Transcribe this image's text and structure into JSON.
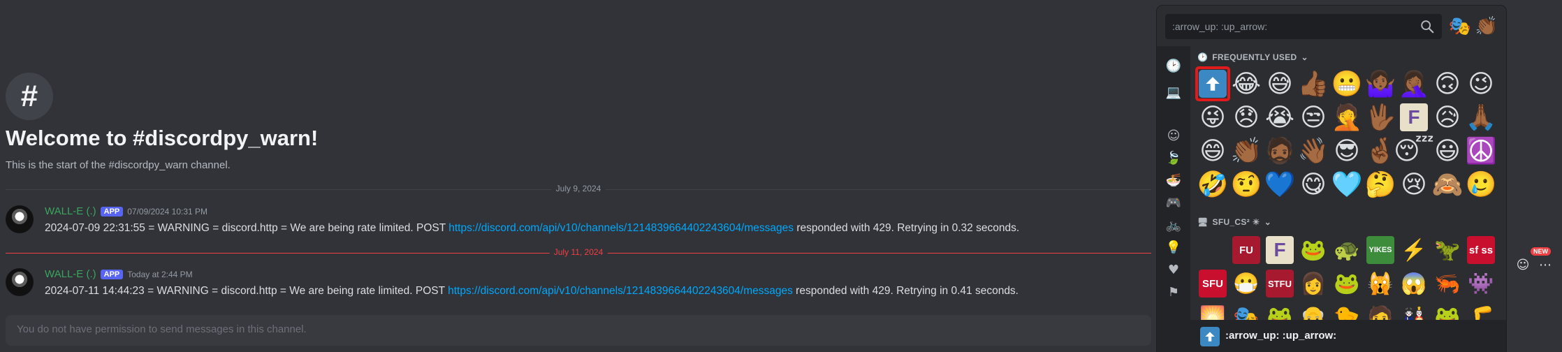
{
  "channel": {
    "hash": "#",
    "welcome_title": "Welcome to #discordpy_warn!",
    "welcome_subtitle": "This is the start of the #discordpy_warn channel."
  },
  "dividers": [
    "July 9, 2024",
    "July 11, 2024"
  ],
  "messages": [
    {
      "username": "WALL-E (.)",
      "badge": "APP",
      "timestamp": "07/09/2024 10:31 PM",
      "text_before": "2024-07-09 22:31:55 = WARNING = discord.http = We are being rate limited. POST ",
      "link": "https://discord.com/api/v10/channels/1214839664402243604/messages",
      "text_after": " responded with 429. Retrying in 0.32 seconds."
    },
    {
      "username": "WALL-E (.)",
      "badge": "APP",
      "timestamp": "Today at 2:44 PM",
      "text_before": "2024-07-11 14:44:23 = WARNING = discord.http = We are being rate limited. POST ",
      "link": "https://discord.com/api/v10/channels/1214839664402243604/messages",
      "text_after": " responded with 429. Retrying in 0.41 seconds."
    }
  ],
  "composer": {
    "placeholder": "You do not have permission to send messages in this channel."
  },
  "side": {
    "new_badge": "NEW"
  },
  "picker": {
    "search_value": ":arrow_up: :up_arrow:",
    "section_frequent": "FREQUENTLY USED",
    "section_server": "SFU_CS² ☀",
    "frequent_emojis": [
      "⬆",
      "😂",
      "😅",
      "👍🏾",
      "😬",
      "🤷🏾‍♀️",
      "🤦🏾‍♀️",
      "🙃",
      "😉",
      "😜",
      "😞",
      "😭",
      "😒",
      "🤦",
      "🖖🏾",
      "F",
      "😥",
      "🙏🏾",
      "😄",
      "👏🏾",
      "🧔🏾",
      "👋🏾",
      "😎",
      "🤞🏾",
      "😴",
      "😃",
      "☮️",
      "🤣",
      "🤨",
      "💙",
      "😋",
      "🩵",
      "🤔",
      "😢",
      "🙈",
      "🥲"
    ],
    "server_stickers": [
      {
        "label": "",
        "color": "#2b2d31"
      },
      {
        "label": "FU",
        "color": "#a6192e"
      },
      {
        "label": "F",
        "color": "#e8e0c8"
      },
      {
        "label": "🐸",
        "color": "#2b2d31"
      },
      {
        "label": "🐢",
        "color": "#2b2d31"
      },
      {
        "label": "YIKES",
        "color": "#3c8c3c"
      },
      {
        "label": "⚡",
        "color": "#2b2d31"
      },
      {
        "label": "🦖",
        "color": "#2b2d31"
      },
      {
        "label": "sf ss",
        "color": "#c8102e"
      },
      {
        "label": "SFU",
        "color": "#c8102e"
      },
      {
        "label": "😷",
        "color": "#2b2d31"
      },
      {
        "label": "STFU",
        "color": "#a6192e"
      },
      {
        "label": "👩",
        "color": "#2b2d31"
      },
      {
        "label": "🐸",
        "color": "#2b2d31"
      },
      {
        "label": "🙀",
        "color": "#2b2d31"
      },
      {
        "label": "😱",
        "color": "#2b2d31"
      },
      {
        "label": "🦐",
        "color": "#2b2d31"
      },
      {
        "label": "👾",
        "color": "#2b2d31"
      },
      {
        "label": "🌅",
        "color": "#2b2d31"
      },
      {
        "label": "🎭",
        "color": "#2b2d31"
      },
      {
        "label": "🐸",
        "color": "#2b2d31"
      },
      {
        "label": "👴",
        "color": "#2b2d31"
      },
      {
        "label": "🐤",
        "color": "#2b2d31"
      },
      {
        "label": "🧑",
        "color": "#2b2d31"
      },
      {
        "label": "🎎",
        "color": "#2b2d31"
      },
      {
        "label": "🐸",
        "color": "#2b2d31"
      },
      {
        "label": "🦵",
        "color": "#2b2d31"
      }
    ],
    "footer_label": ":arrow_up: :up_arrow:"
  },
  "colors": {
    "accent": "#5865f2",
    "link": "#00a8fc",
    "selected_outline": "#e01b1b",
    "new_divider": "#f23f42"
  }
}
